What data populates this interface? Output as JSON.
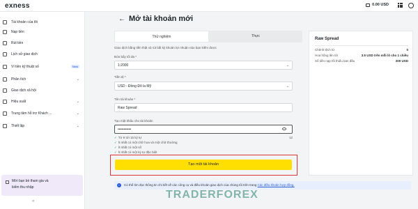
{
  "header": {
    "logo": "exness",
    "balance": "0.00 USD"
  },
  "sidebar": {
    "items": [
      {
        "label": "Tài khoản của tôi"
      },
      {
        "label": "Nạp tiền"
      },
      {
        "label": "Rút tiền"
      },
      {
        "label": "Lịch sử giao dịch"
      },
      {
        "label": "Ví tiền kỹ thuật số",
        "badge": "New"
      },
      {
        "label": "Phân tích",
        "chevron": "⌄"
      },
      {
        "label": "Giao dịch xã hội"
      },
      {
        "label": "Hiệu suất",
        "chevron": "⌄"
      },
      {
        "label": "Trung tâm hỗ trợ Khách ...",
        "chevron": "⌄"
      },
      {
        "label": "Thiết lập",
        "chevron": "⌄"
      }
    ],
    "promo": {
      "line1": "Mời bạn bè tham gia và",
      "line2": "kiếm thu nhập"
    },
    "collapse": "«"
  },
  "page": {
    "back": "←",
    "title": "Mở tài khoản mới"
  },
  "form": {
    "tabs": [
      {
        "label": "Thử nghiệm"
      },
      {
        "label": "Thực"
      }
    ],
    "description": "Giao dịch bằng tiền thật và rút bất kỳ khoản lợi nhuận nào bạn kiếm được",
    "leverage": {
      "label": "Đòn bẩy tối đa *",
      "value": "1:2000"
    },
    "currency": {
      "label": "Tiền tệ *",
      "value": "USD - Đồng Đô la Mỹ"
    },
    "account_name": {
      "label": "Tên tài khoản *",
      "value": "Raw Spread"
    },
    "password": {
      "label": "Tạo mật khẩu cho tài khoản",
      "value": "•••••••••••",
      "count": "12"
    },
    "rules": [
      "Từ 8 tới 15 ký tự",
      "Ít nhất có một chữ hoa và một chữ thường",
      "Ít nhất có một số",
      "Ít nhất có một ký tự đặc biệt"
    ],
    "submit_label": "Tạo một tài khoản"
  },
  "info": {
    "text": "Có thể tìm đọc thông tin chi tiết về các công cụ và điều khoản giao dịch của chúng tôi trên trang ",
    "link": "Các điều khoản hợp đồng."
  },
  "panel": {
    "title": "Raw Spread",
    "rows": [
      {
        "label": "Chênh lệch từ",
        "value": "0"
      },
      {
        "label": "Hoa hồng lên tới",
        "value": "3.5 USD trên mỗi lô cho 1 chiều"
      },
      {
        "label": "Số tiền nạp tối thiểu ban đầu",
        "value": "200 USD"
      }
    ]
  },
  "watermark": "TRADERFOREX"
}
